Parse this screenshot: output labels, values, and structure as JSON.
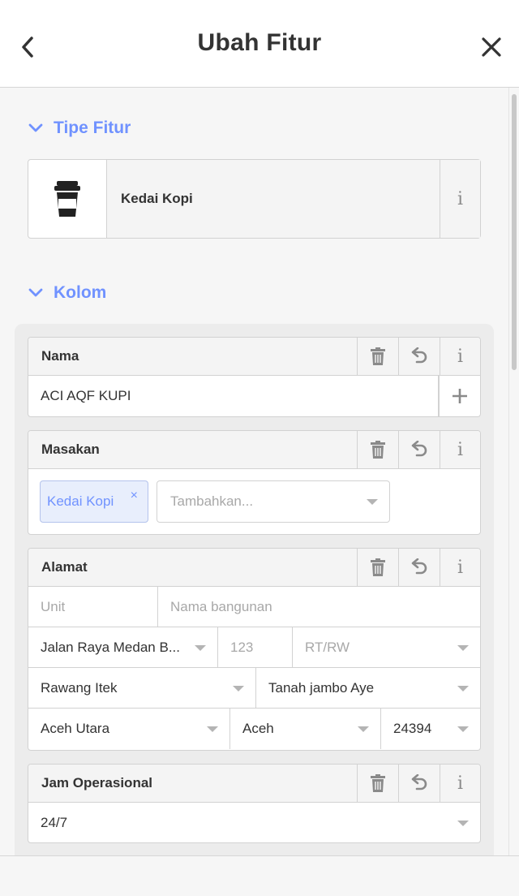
{
  "header": {
    "title": "Ubah Fitur"
  },
  "preset_section": {
    "label": "Tipe Fitur",
    "preset_name": "Kedai Kopi",
    "info_glyph": "i"
  },
  "fields_section": {
    "label": "Kolom"
  },
  "fields": {
    "name": {
      "label": "Nama",
      "value": "ACI AQF KUPI",
      "info_glyph": "i"
    },
    "cuisine": {
      "label": "Masakan",
      "chip": "Kedai Kopi",
      "chip_remove": "×",
      "placeholder": "Tambahkan...",
      "info_glyph": "i"
    },
    "address": {
      "label": "Alamat",
      "unit_placeholder": "Unit",
      "building_placeholder": "Nama bangunan",
      "street": "Jalan Raya Medan B...",
      "housenumber_placeholder": "123",
      "rtrw_placeholder": "RT/RW",
      "village": "Rawang Itek",
      "district": "Tanah jambo Aye",
      "regency": "Aceh Utara",
      "province": "Aceh",
      "postcode": "24394",
      "info_glyph": "i"
    },
    "opening_hours": {
      "label": "Jam Operasional",
      "value": "24/7",
      "info_glyph": "i"
    }
  },
  "colors": {
    "accent": "#7092ff",
    "panel_bg": "#f6f6f6",
    "border": "#d2d2d2"
  },
  "icons": {
    "back": "chevron-left-icon",
    "close": "close-icon",
    "preset": "coffee-cup-icon",
    "delete": "trash-icon",
    "revert": "undo-icon",
    "info": "info-icon",
    "add": "plus-icon"
  }
}
